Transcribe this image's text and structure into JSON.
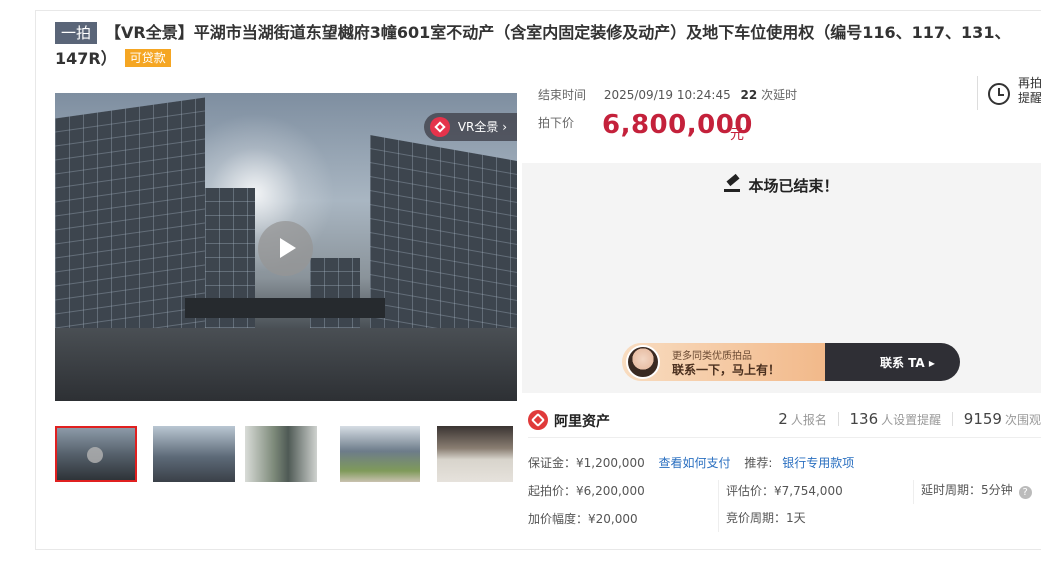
{
  "title": {
    "round_badge": "一拍",
    "text": "【VR全景】平湖市当湖街道东望樾府3幢601室不动产（含室内固定装修及动产）及地下车位使用权（编号116、117、131、147R）",
    "loan_badge": "可贷款"
  },
  "media": {
    "vr_label": "VR全景 ›",
    "thumbnails": [
      "thumb-1",
      "thumb-2",
      "thumb-3",
      "thumb-4",
      "thumb-5"
    ]
  },
  "auction": {
    "end_label": "结束时间",
    "end_time": "2025/09/19 10:24:45",
    "delay_count": "22",
    "delay_suffix": "次延时",
    "price_label": "拍下价",
    "price": "6,800,000",
    "price_unit": "元",
    "remind_label": "再拍提醒",
    "status": "本场已结束！"
  },
  "ad": {
    "line1": "更多同类优质拍品",
    "line2": "联系一下，马上有！",
    "cta": "联系 TA ▸"
  },
  "org": {
    "name": "阿里资产",
    "signups": "2",
    "signups_label": "人报名",
    "reminders": "136",
    "reminders_label": "人设置提醒",
    "views": "9159",
    "views_label": "次围观"
  },
  "details": {
    "deposit": "保证金：¥1,200,000",
    "how_to_pay": "查看如何支付",
    "recommend_label": "推荐:",
    "bank_link": "银行专用款项",
    "start_price": "起拍价：¥6,200,000",
    "appraisal": "评估价：¥7,754,000",
    "delay_period": "延时周期：5分钟",
    "increment": "加价幅度：¥20,000",
    "bid_period": "竞价周期：1天"
  },
  "colors": {
    "price_red": "#c4213b",
    "link_blue": "#2a6fc0",
    "loan_orange": "#f5a623",
    "thumb_active": "#e02020"
  }
}
